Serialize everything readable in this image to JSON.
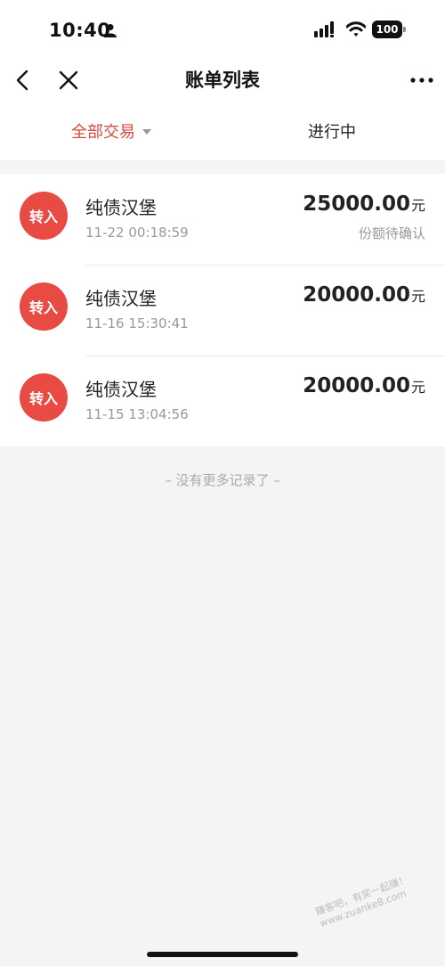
{
  "status_bar": {
    "time": "10:40",
    "battery": "100"
  },
  "nav": {
    "title": "账单列表"
  },
  "tabs": [
    {
      "label": "全部交易",
      "active": true
    },
    {
      "label": "进行中",
      "active": false
    }
  ],
  "transactions": [
    {
      "badge": "转入",
      "name": "纯债汉堡",
      "time": "11-22 00:18:59",
      "amount": "25000.00",
      "unit": "元",
      "status": "份额待确认"
    },
    {
      "badge": "转入",
      "name": "纯债汉堡",
      "time": "11-16 15:30:41",
      "amount": "20000.00",
      "unit": "元",
      "status": ""
    },
    {
      "badge": "转入",
      "name": "纯债汉堡",
      "time": "11-15 13:04:56",
      "amount": "20000.00",
      "unit": "元",
      "status": ""
    }
  ],
  "footer": {
    "no_more": "– 没有更多记录了 –"
  },
  "watermark": "赚客吧，有奖一起赚！www.zuanke8.com",
  "colors": {
    "accent": "#d8493c",
    "badge": "#e84a44"
  }
}
